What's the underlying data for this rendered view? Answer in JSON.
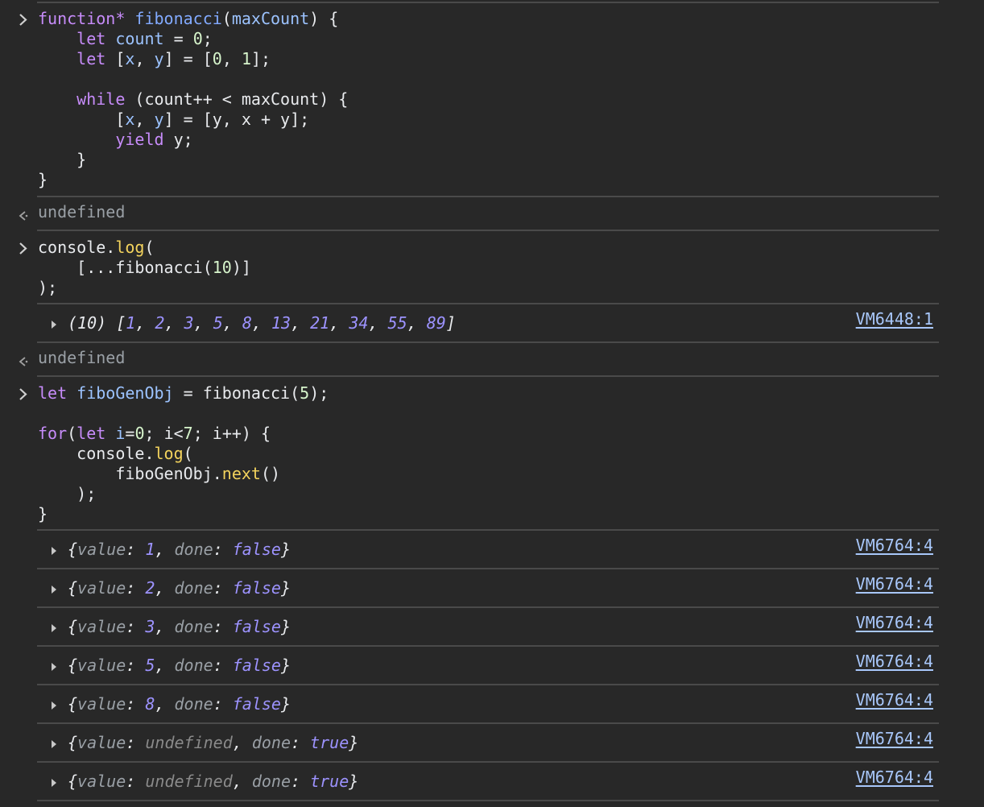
{
  "block1": {
    "l1": {
      "kw": "function*",
      "fn": "fibonacci",
      "open": "(",
      "arg": "maxCount",
      "close": ") {"
    },
    "l2": {
      "kw": "let",
      "var": "count",
      "eq": " = ",
      "num": "0",
      "end": ";"
    },
    "l3": {
      "kw": "let",
      "b1": " [",
      "x": "x",
      "comma": ", ",
      "y": "y",
      "b2": "] = [",
      "n0": "0",
      "c2": ", ",
      "n1": "1",
      "end": "];"
    },
    "l5": {
      "kw": "while",
      "rest": " (count++ < maxCount) {"
    },
    "l6": {
      "b1": "[",
      "x": "x",
      "c": ", ",
      "y": "y",
      "rest": "] = [y, x + y];"
    },
    "l7": {
      "kw": "yield",
      "rest": " y;"
    },
    "l8": "}",
    "l9": "}"
  },
  "result1": "undefined",
  "block2": {
    "l1": {
      "obj": "console.",
      "meth": "log",
      "end": "("
    },
    "l2": {
      "a": "[...fibonacci(",
      "num": "10",
      "b": ")]"
    },
    "l3": ");"
  },
  "log_array": {
    "count": "(10)",
    "values": [
      "1",
      "2",
      "3",
      "5",
      "8",
      "13",
      "21",
      "34",
      "55",
      "89"
    ],
    "source": "VM6448:1"
  },
  "result2": "undefined",
  "block3": {
    "l1": {
      "kw": "let",
      "var": "fiboGenObj",
      "eq": " = fibonacci(",
      "num": "5",
      "end": ");"
    },
    "l3": {
      "kw": "for",
      "p": "(",
      "kw2": "let",
      "var": "i",
      "eq": "=",
      "n0": "0",
      "a": "; i<",
      "n7": "7",
      "b": "; i++) {"
    },
    "l4": {
      "obj": "console.",
      "meth": "log",
      "end": "("
    },
    "l5": {
      "obj": "fiboGenObj.",
      "meth": "next",
      "end": "()"
    },
    "l6": ");",
    "l7": "}"
  },
  "generator_logs": [
    {
      "value": "1",
      "done": "false",
      "source": "VM6764:4"
    },
    {
      "value": "2",
      "done": "false",
      "source": "VM6764:4"
    },
    {
      "value": "3",
      "done": "false",
      "source": "VM6764:4"
    },
    {
      "value": "5",
      "done": "false",
      "source": "VM6764:4"
    },
    {
      "value": "8",
      "done": "false",
      "source": "VM6764:4"
    },
    {
      "value": "undefined",
      "done": "true",
      "source": "VM6764:4"
    },
    {
      "value": "undefined",
      "done": "true",
      "source": "VM6764:4"
    }
  ],
  "labels": {
    "value_key": "value",
    "done_key": "done"
  },
  "colors": {
    "background": "#282828",
    "keyword": "#c78cfa",
    "function": "#82aaff",
    "number": "#d7f5cc",
    "method": "#f3d35d",
    "link": "#a8c7fa",
    "log_number": "#9d93ff"
  }
}
